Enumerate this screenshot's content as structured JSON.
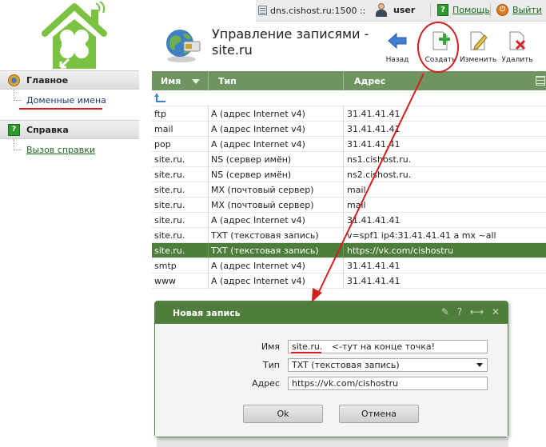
{
  "app": {
    "host_label": "dns.cishost.ru:1500 ::",
    "user_name": "user",
    "help_label": "Помощь",
    "logout_label": "Выйти"
  },
  "page": {
    "title": "Управление записями - site.ru"
  },
  "toolbar": {
    "back_label": "Назад",
    "create_label": "Создать",
    "edit_label": "Изменить",
    "delete_label": "Удалить"
  },
  "sidebar": {
    "sections": [
      {
        "title": "Главное",
        "items": [
          "Доменные имена"
        ]
      },
      {
        "title": "Справка",
        "items": [
          "Вызов справки"
        ]
      }
    ]
  },
  "table": {
    "columns": [
      "Имя",
      "Тип",
      "Адрес"
    ],
    "rows": [
      {
        "name": "ftp",
        "type": "A (адрес Internet v4)",
        "address": "31.41.41.41"
      },
      {
        "name": "mail",
        "type": "A (адрес Internet v4)",
        "address": "31.41.41.41"
      },
      {
        "name": "pop",
        "type": "A (адрес Internet v4)",
        "address": "31.41.41.41"
      },
      {
        "name": "site.ru.",
        "type": "NS (сервер имён)",
        "address": "ns1.cishost.ru."
      },
      {
        "name": "site.ru.",
        "type": "NS (сервер имён)",
        "address": "ns2.cishost.ru."
      },
      {
        "name": "site.ru.",
        "type": "MX (почтовый сервер)",
        "address": "mail"
      },
      {
        "name": "site.ru.",
        "type": "MX (почтовый сервер)",
        "address": "mail"
      },
      {
        "name": "site.ru.",
        "type": "A (адрес Internet v4)",
        "address": "31.41.41.41"
      },
      {
        "name": "site.ru.",
        "type": "TXT (текстовая запись)",
        "address": "v=spf1 ip4:31.41.41.41 a mx ~all"
      },
      {
        "name": "site.ru.",
        "type": "TXT (текстовая запись)",
        "address": "https://vk.com/cishostru"
      },
      {
        "name": "smtp",
        "type": "A (адрес Internet v4)",
        "address": "31.41.41.41"
      },
      {
        "name": "www",
        "type": "A (адрес Internet v4)",
        "address": "31.41.41.41"
      }
    ],
    "selected_row": 9
  },
  "dialog": {
    "title": "Новая запись",
    "tools": [
      "✎",
      "?",
      "⟷",
      "✕"
    ],
    "name_label": "Имя",
    "name_value": "site.ru.",
    "name_note": "<-тут на конце точка!",
    "type_label": "Тип",
    "type_value": "TXT (текстовая запись)",
    "address_label": "Адрес",
    "address_value": "https://vk.com/cishostru",
    "ok_label": "Ok",
    "cancel_label": "Отмена"
  },
  "colors": {
    "header_green": "#6f9460",
    "selected_row": "#4d7d3a",
    "dialog_head": "#4f7d3b",
    "annotation_red": "#d51e1e"
  }
}
